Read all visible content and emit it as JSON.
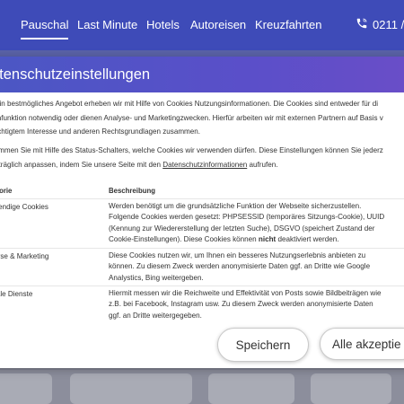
{
  "colors": {
    "nav_background": "#3e4bb8",
    "modal_header": "#4b57c4",
    "overlay": "#7f8291"
  },
  "nav": {
    "items": [
      {
        "label": "Pauschal",
        "active": true
      },
      {
        "label": "Last Minute",
        "active": false
      },
      {
        "label": "Hotels",
        "active": false
      },
      {
        "label": "Autoreisen",
        "active": false
      },
      {
        "label": "Kreuzfahrten",
        "active": false
      }
    ],
    "phone_icon": "phone-icon",
    "phone": "0211 /"
  },
  "modal": {
    "title": "atenschutzeinstellungen",
    "intro": [
      "r ein bestmögliches Angebot erheben wir mit Hilfe von Cookies Nutzungsinformationen. Die Cookies sind entweder für di",
      "tenfunktion notwendig oder dienen Analyse- und Marketingzwecken. Hierfür arbeiten wir mit externen Partnern auf Basis v",
      "rechtigtem Interesse und anderen Rechtsgrundlagen zusammen."
    ],
    "settings_line1": "stimmen Sie mit Hilfe des Status-Schalters, welche Cookies wir verwenden dürfen. Diese Einstellungen können Sie jederz",
    "settings_line2_prefix": "chträglich anpassen, indem Sie unsere Seite mit den ",
    "settings_link": "Datenschutzinformationen",
    "settings_line2_suffix": " aufrufen.",
    "table": {
      "col_category": "egorie",
      "col_description": "Beschreibung",
      "rows": [
        {
          "category": "twendige Cookies",
          "description": [
            "Werden benötigt um die grundsätzliche Funktion der Webseite sicherzustellen.",
            "Folgende Cookies werden gesetzt: PHPSESSID (temporäres Sitzungs-Cookie), UUID",
            "(Kennung zur Wiedererstellung der letzten Suche), DSGVO (speichert Zustand der",
            "Cookie-Einstellungen). Diese Cookies können "
          ],
          "desc_bold": "nicht",
          "desc_tail": " deaktiviert werden."
        },
        {
          "category": "alyse & Marketing",
          "description": [
            "Diese Cookies nutzen wir, um Ihnen ein besseres Nutzungserlebnis anbieten zu",
            "können. Zu diesem Zweck werden anonymisierte Daten ggf. an Dritte wie Google",
            "Analystics, Bing weitergeben."
          ]
        },
        {
          "category": "ziale Dienste",
          "description": [
            "Hiermit messen wir die Reichweite und Effektivität von Posts sowie Bildbeiträgen wie",
            "z.B. bei Facebook, Instagram usw. Zu diesem Zweck werden anonymisierte Daten",
            "ggf. an Dritte weitergegeben."
          ]
        }
      ]
    },
    "buttons": {
      "save": "Speichern",
      "accept_all": "Alle akzeptie"
    }
  }
}
